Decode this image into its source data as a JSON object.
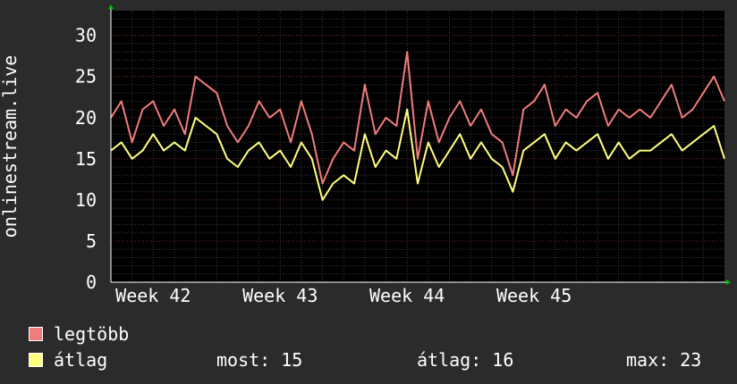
{
  "chart_data": {
    "type": "line",
    "ylabel": "onlinestream.live",
    "yticks": [
      0,
      5,
      10,
      15,
      20,
      25,
      30
    ],
    "ylim": [
      0,
      33
    ],
    "x_tick_labels": [
      "Week 42",
      "Week 43",
      "Week 44",
      "Week 45"
    ],
    "x_domain": [
      0,
      29
    ],
    "x_ticks": [
      2,
      8,
      14,
      20
    ],
    "grid": true,
    "series": [
      {
        "name": "legtöbb",
        "color": "#f07c7c",
        "x": [
          0,
          0.5,
          1,
          1.5,
          2,
          2.5,
          3,
          3.5,
          4,
          4.5,
          5,
          5.5,
          6,
          6.5,
          7,
          7.5,
          8,
          8.5,
          9,
          9.5,
          10,
          10.5,
          11,
          11.5,
          12,
          12.5,
          13,
          13.5,
          14,
          14.5,
          15,
          15.5,
          16,
          16.5,
          17,
          17.5,
          18,
          18.5,
          19,
          19.5,
          20,
          20.5,
          21,
          21.5,
          22,
          22.5,
          23,
          23.5,
          24,
          24.5,
          25,
          25.5,
          26,
          26.5,
          27,
          27.5,
          28,
          28.5,
          29
        ],
        "values": [
          20,
          22,
          17,
          21,
          22,
          19,
          21,
          18,
          25,
          24,
          23,
          19,
          17,
          19,
          22,
          20,
          21,
          17,
          22,
          18,
          12,
          15,
          17,
          16,
          24,
          18,
          20,
          19,
          28,
          15,
          22,
          17,
          20,
          22,
          19,
          21,
          18,
          17,
          13,
          21,
          22,
          24,
          19,
          21,
          20,
          22,
          23,
          19,
          21,
          20,
          21,
          20,
          22,
          24,
          20,
          21,
          23,
          25,
          22
        ]
      },
      {
        "name": "átlag",
        "color": "#ffff80",
        "x": [
          0,
          0.5,
          1,
          1.5,
          2,
          2.5,
          3,
          3.5,
          4,
          4.5,
          5,
          5.5,
          6,
          6.5,
          7,
          7.5,
          8,
          8.5,
          9,
          9.5,
          10,
          10.5,
          11,
          11.5,
          12,
          12.5,
          13,
          13.5,
          14,
          14.5,
          15,
          15.5,
          16,
          16.5,
          17,
          17.5,
          18,
          18.5,
          19,
          19.5,
          20,
          20.5,
          21,
          21.5,
          22,
          22.5,
          23,
          23.5,
          24,
          24.5,
          25,
          25.5,
          26,
          26.5,
          27,
          27.5,
          28,
          28.5,
          29
        ],
        "values": [
          16,
          17,
          15,
          16,
          18,
          16,
          17,
          16,
          20,
          19,
          18,
          15,
          14,
          16,
          17,
          15,
          16,
          14,
          17,
          15,
          10,
          12,
          13,
          12,
          18,
          14,
          16,
          15,
          21,
          12,
          17,
          14,
          16,
          18,
          15,
          17,
          15,
          14,
          11,
          16,
          17,
          18,
          15,
          17,
          16,
          17,
          18,
          15,
          17,
          15,
          16,
          16,
          17,
          18,
          16,
          17,
          18,
          19,
          15
        ]
      }
    ]
  },
  "legend": {
    "max_label": "legtöbb",
    "avg_label": "átlag"
  },
  "stats": {
    "now": "most: 15",
    "avg": "átlag: 16",
    "max": "max: 23"
  }
}
